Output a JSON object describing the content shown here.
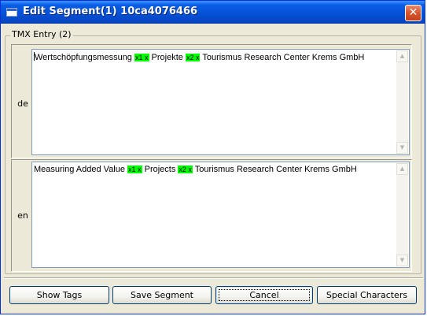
{
  "window": {
    "title": "Edit Segment(1) 10ca4076466",
    "close_symbol": "✕"
  },
  "group": {
    "title": "TMX Entry (2)"
  },
  "entries": [
    {
      "lang": "de",
      "segments": [
        "Wertschöpfungsmessung ",
        "x1 x",
        " Projekte ",
        "x2 x",
        " Tourismus Research Center Krems GmbH"
      ]
    },
    {
      "lang": "en",
      "segments": [
        "Measuring Added Value ",
        "x1 x",
        " Projects ",
        "x2 x",
        " Tourismus Research Center Krems GmbH"
      ]
    }
  ],
  "buttons": {
    "show_tags": "Show Tags",
    "save_segment": "Save Segment",
    "cancel": "Cancel",
    "special_characters": "Special Characters"
  },
  "colors": {
    "tag_highlight": "#00ff00",
    "titlebar": "#0553d8"
  }
}
